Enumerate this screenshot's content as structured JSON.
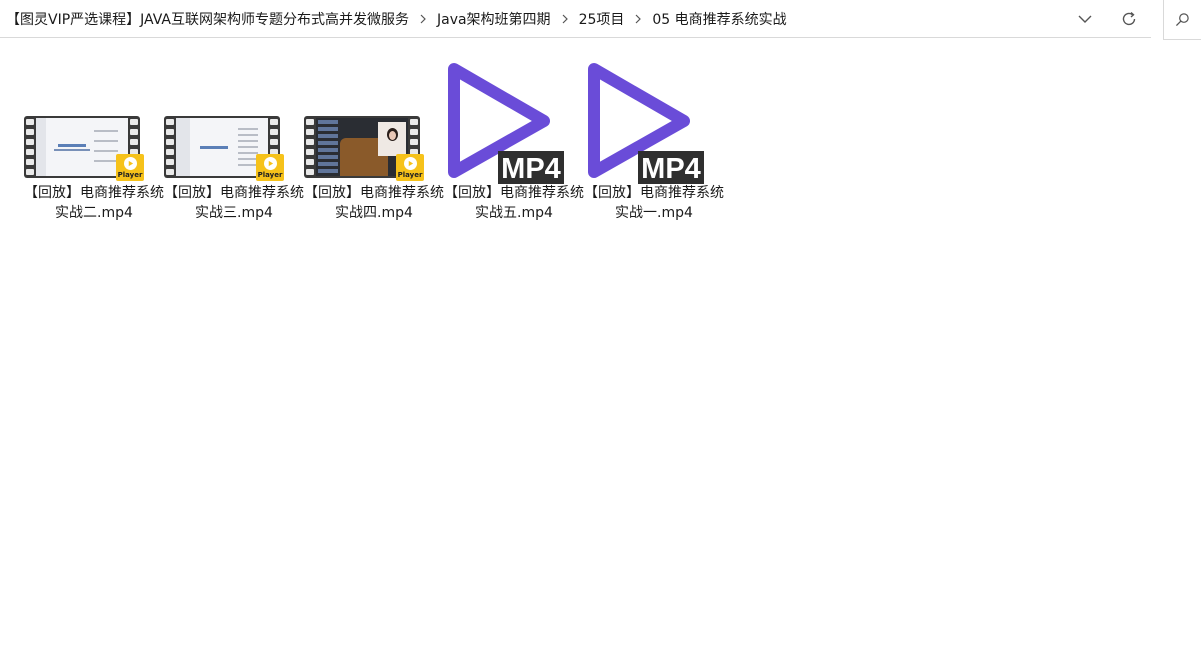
{
  "breadcrumb": {
    "items": [
      "【图灵VIP严选课程】JAVA互联网架构师专题分布式高并发微服务",
      "Java架构班第四期",
      "25项目",
      "05 电商推荐系统实战"
    ]
  },
  "colors": {
    "mp4_purple": "#6a4cd8",
    "player_yellow": "#f6c21a"
  },
  "files": [
    {
      "name": "【回放】电商推荐系统实战二.mp4",
      "thumb": "video-thumbnail-slides",
      "badge": "Player"
    },
    {
      "name": "【回放】电商推荐系统实战三.mp4",
      "thumb": "video-thumbnail-slides",
      "badge": "Player"
    },
    {
      "name": "【回放】电商推荐系统实战四.mp4",
      "thumb": "video-thumbnail-webcam",
      "badge": "Player"
    },
    {
      "name": "【回放】电商推荐系统实战五.mp4",
      "thumb": "mp4-icon",
      "icon_text": "MP4"
    },
    {
      "name": "【回放】电商推荐系统实战一.mp4",
      "thumb": "mp4-icon",
      "icon_text": "MP4"
    }
  ]
}
